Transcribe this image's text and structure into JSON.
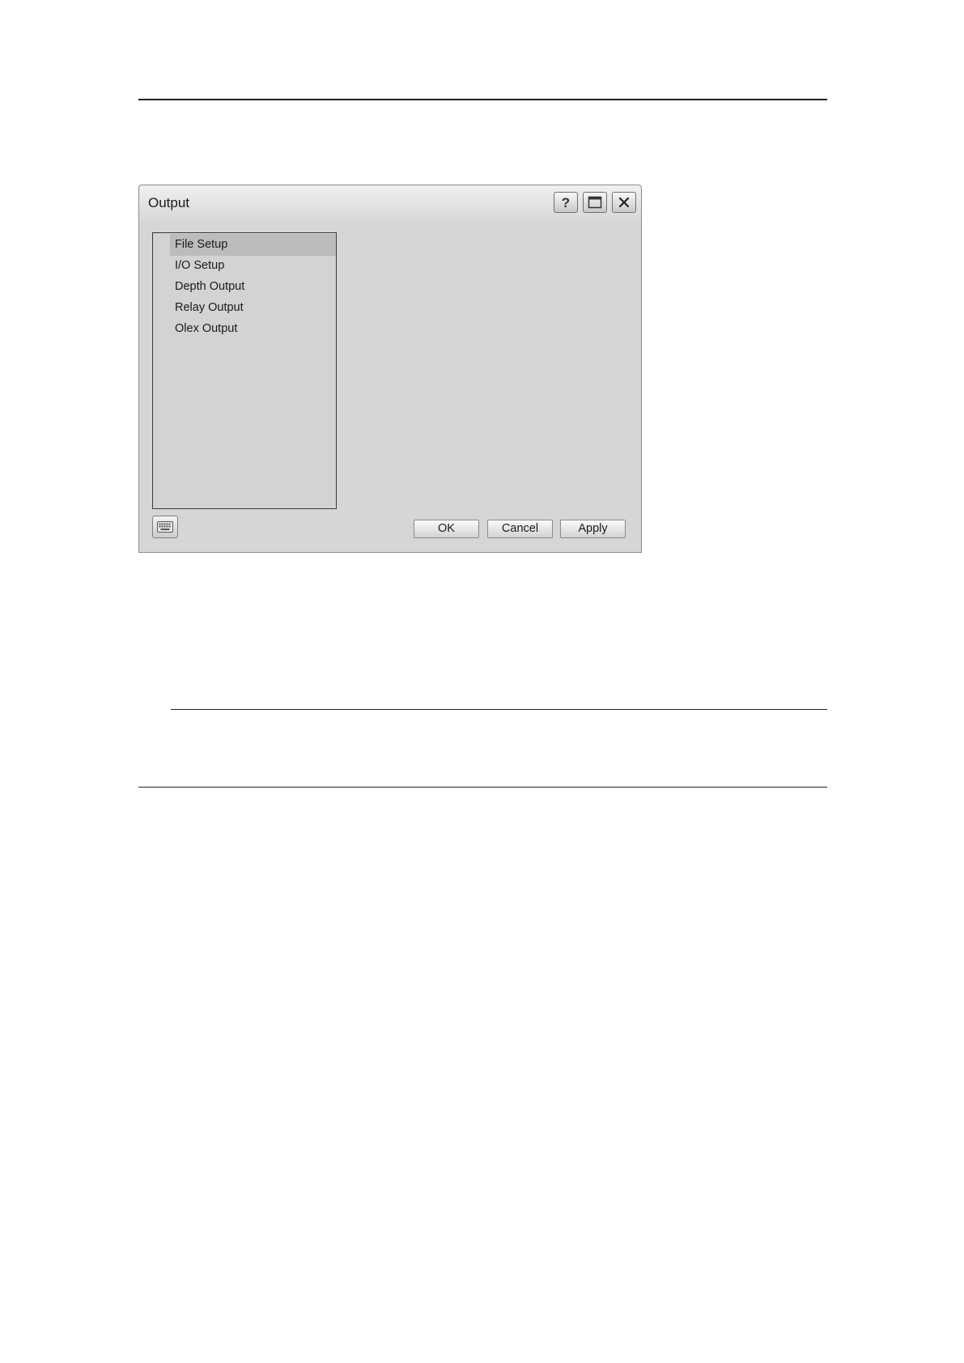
{
  "dialog": {
    "title": "Output",
    "titlebar_buttons": {
      "help": {
        "icon": "help-icon",
        "glyph": "?"
      },
      "maximize": {
        "icon": "maximize-icon"
      },
      "close": {
        "icon": "close-icon"
      }
    },
    "list": {
      "items": [
        {
          "label": "File Setup",
          "selected": true
        },
        {
          "label": "I/O Setup",
          "selected": false
        },
        {
          "label": "Depth Output",
          "selected": false
        },
        {
          "label": "Relay Output",
          "selected": false
        },
        {
          "label": "Olex Output",
          "selected": false
        }
      ]
    },
    "keyboard_button": {
      "icon": "keyboard-icon"
    },
    "buttons": {
      "ok": "OK",
      "cancel": "Cancel",
      "apply": "Apply"
    }
  },
  "colors": {
    "dialog_background": "#d6d6d6",
    "list_selection": "#bcbcbc",
    "page_background": "#ffffff"
  }
}
